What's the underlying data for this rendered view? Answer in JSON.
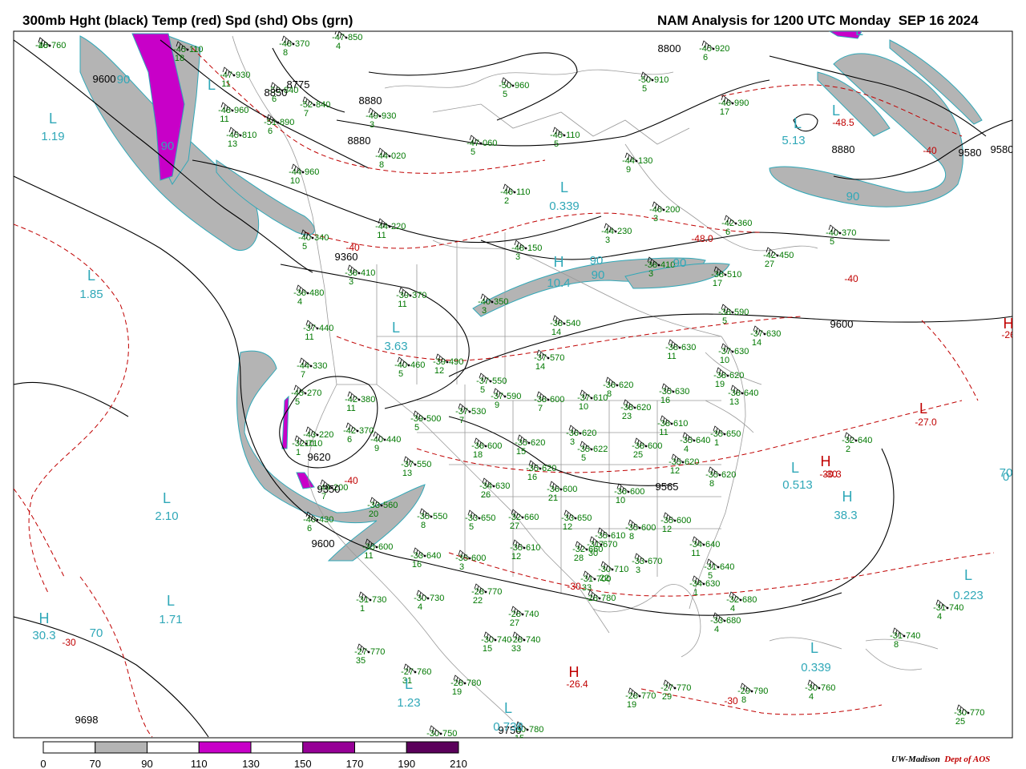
{
  "header": {
    "title_left": "300mb Hght (black) Temp (red) Spd (shd) Obs (grn)",
    "title_right": "NAM Analysis for 1200 UTC Monday  SEP 16 2024"
  },
  "legend": {
    "ticks": [
      "0",
      "70",
      "90",
      "110",
      "130",
      "150",
      "170",
      "190",
      "210"
    ],
    "fills": [
      "#ffffff",
      "#b4b4b4",
      "#ffffff",
      "#c800c8",
      "#ffffff",
      "#960096",
      "#ffffff",
      "#5a005a"
    ]
  },
  "credit": {
    "org": "UW-Madison",
    "dept": "Dept of AOS"
  },
  "colors": {
    "height_contour": "#000000",
    "temp_contour": "#c00000",
    "speed_shade_70": "#b4b4b4",
    "speed_shade_110": "#c800c8",
    "speed_label": "#30a8b8",
    "obs": "#007800",
    "land_border": "#9a9a9a"
  },
  "height_labels": [
    "9600",
    "8800",
    "8880",
    "8880",
    "8775",
    "8850",
    "8880",
    "9580",
    "9580",
    "9360",
    "9600",
    "9620",
    "9350",
    "9600",
    "9565",
    "9698",
    "9750"
  ],
  "temp_labels": [
    "-40",
    "-48.5",
    "-40",
    "-48.0",
    "-40",
    "-27.0",
    "-30",
    "-30",
    "-26.4",
    "-30",
    "-30.3",
    "-26",
    "-30",
    "-40"
  ],
  "centers": [
    {
      "t": "L",
      "v": "1.19",
      "c": "speed"
    },
    {
      "t": "L",
      "v": "1.85",
      "c": "speed"
    },
    {
      "t": "L",
      "v": "2.10",
      "c": "speed"
    },
    {
      "t": "L",
      "v": "1.71",
      "c": "speed"
    },
    {
      "t": "H",
      "v": "30.3",
      "c": "speed"
    },
    {
      "t": "L",
      "v": "1.23",
      "c": "speed"
    },
    {
      "t": "L",
      "v": "0.738",
      "c": "speed"
    },
    {
      "t": "L",
      "v": "0.339",
      "c": "speed"
    },
    {
      "t": "L",
      "v": "3.63",
      "c": "speed"
    },
    {
      "t": "H",
      "v": "10.4",
      "c": "speed"
    },
    {
      "t": "L",
      "v": "5.13",
      "c": "speed"
    },
    {
      "t": "L",
      "v": "0.513",
      "c": "speed"
    },
    {
      "t": "H",
      "v": "38.3",
      "c": "speed"
    },
    {
      "t": "L",
      "v": "0.223",
      "c": "speed"
    },
    {
      "t": "L",
      "v": "0.339",
      "c": "speed"
    },
    {
      "t": "H",
      "v": "",
      "c": "temp"
    },
    {
      "t": "H",
      "v": "",
      "c": "temp"
    },
    {
      "t": "H",
      "v": "",
      "c": "temp"
    },
    {
      "t": "L",
      "v": "",
      "c": "temp"
    },
    {
      "t": "L",
      "v": "",
      "c": "speed"
    },
    {
      "t": "L",
      "v": "",
      "c": "speed"
    },
    {
      "t": "L",
      "v": "",
      "c": "speed"
    }
  ],
  "speed_labels": [
    "90",
    "90",
    "90",
    "90",
    "90",
    "90",
    "70",
    "70",
    "0"
  ],
  "observations": [
    {
      "t": "-45",
      "v": "110",
      "d": "18"
    },
    {
      "t": "-47",
      "v": "930",
      "d": "11"
    },
    {
      "t": "-48",
      "v": "370",
      "d": "8"
    },
    {
      "t": "-47",
      "v": "850",
      "d": "4"
    },
    {
      "t": "-50",
      "v": "840",
      "d": "6"
    },
    {
      "t": "-52",
      "v": "840",
      "d": "7"
    },
    {
      "t": "-48",
      "v": "960",
      "d": "11"
    },
    {
      "t": "-51",
      "v": "890",
      "d": "6"
    },
    {
      "t": "-49",
      "v": "930",
      "d": "3"
    },
    {
      "t": "-45",
      "v": "810",
      "d": "13"
    },
    {
      "t": "-44",
      "v": "960",
      "d": "10"
    },
    {
      "t": "-44",
      "v": "020",
      "d": "8"
    },
    {
      "t": "-47",
      "v": "060",
      "d": "5"
    },
    {
      "t": "-45",
      "v": "110",
      "d": "5"
    },
    {
      "t": "-50",
      "v": "960",
      "d": "5"
    },
    {
      "t": "-45",
      "v": "920",
      "d": "6"
    },
    {
      "t": "-50",
      "v": "910",
      "d": "5"
    },
    {
      "t": "-46",
      "v": "990",
      "d": "17"
    },
    {
      "t": "-44",
      "v": "130",
      "d": "9"
    },
    {
      "t": "-46",
      "v": "110",
      "d": "2"
    },
    {
      "t": "-46",
      "v": "200",
      "d": "3"
    },
    {
      "t": "-44",
      "v": "230",
      "d": "3"
    },
    {
      "t": "-42",
      "v": "360",
      "d": "6"
    },
    {
      "t": "-40",
      "v": "370",
      "d": "5"
    },
    {
      "t": "-42",
      "v": "450",
      "d": "27"
    },
    {
      "t": "-44",
      "v": "220",
      "d": "11"
    },
    {
      "t": "-40",
      "v": "340",
      "d": "5"
    },
    {
      "t": "-48",
      "v": "150",
      "d": "3"
    },
    {
      "t": "-38",
      "v": "410",
      "d": "3"
    },
    {
      "t": "-39",
      "v": "370",
      "d": "11"
    },
    {
      "t": "-36",
      "v": "480",
      "d": "4"
    },
    {
      "t": "-40",
      "v": "350",
      "d": "3"
    },
    {
      "t": "-38",
      "v": "410",
      "d": "3"
    },
    {
      "t": "-38",
      "v": "510",
      "d": "17"
    },
    {
      "t": "-38",
      "v": "540",
      "d": "14"
    },
    {
      "t": "-37",
      "v": "440",
      "d": "11"
    },
    {
      "t": "-38",
      "v": "590",
      "d": "5"
    },
    {
      "t": "-37",
      "v": "630",
      "d": "14"
    },
    {
      "t": "-38",
      "v": "630",
      "d": "11"
    },
    {
      "t": "-37",
      "v": "630",
      "d": "10"
    },
    {
      "t": "-44",
      "v": "330",
      "d": "7"
    },
    {
      "t": "-40",
      "v": "460",
      "d": "5"
    },
    {
      "t": "-39",
      "v": "490",
      "d": "12"
    },
    {
      "t": "-37",
      "v": "570",
      "d": "14"
    },
    {
      "t": "-38",
      "v": "620",
      "d": "19"
    },
    {
      "t": "-38",
      "v": "640",
      "d": "13"
    },
    {
      "t": "-45",
      "v": "270",
      "d": "5"
    },
    {
      "t": "-42",
      "v": "380",
      "d": "11"
    },
    {
      "t": "-37",
      "v": "550",
      "d": "5"
    },
    {
      "t": "-37",
      "v": "590",
      "d": "9"
    },
    {
      "t": "-38",
      "v": "600",
      "d": "7"
    },
    {
      "t": "-37",
      "v": "610",
      "d": "10"
    },
    {
      "t": "-36",
      "v": "620",
      "d": "8"
    },
    {
      "t": "-38",
      "v": "620",
      "d": "23"
    },
    {
      "t": "-35",
      "v": "630",
      "d": "16"
    },
    {
      "t": "-43",
      "v": "220",
      "d": "10"
    },
    {
      "t": "-42",
      "v": "370",
      "d": "6"
    },
    {
      "t": "-39",
      "v": "500",
      "d": "5"
    },
    {
      "t": "-37",
      "v": "530",
      "d": "7"
    },
    {
      "t": "-38",
      "v": "610",
      "d": "11"
    },
    {
      "t": "-36",
      "v": "620",
      "d": "3"
    },
    {
      "t": "-35",
      "v": "640",
      "d": "4"
    },
    {
      "t": "-35",
      "v": "650",
      "d": "1"
    },
    {
      "t": "-40",
      "v": "440",
      "d": "9"
    },
    {
      "t": "-36",
      "v": "600",
      "d": "18"
    },
    {
      "t": "-35",
      "v": "620",
      "d": "15"
    },
    {
      "t": "-35",
      "v": "622",
      "d": "5"
    },
    {
      "t": "-38",
      "v": "600",
      "d": "25"
    },
    {
      "t": "-37",
      "v": "550",
      "d": "13"
    },
    {
      "t": "-35",
      "v": "620",
      "d": "16"
    },
    {
      "t": "-34",
      "v": "630",
      "d": "26"
    },
    {
      "t": "-36",
      "v": "600",
      "d": "21"
    },
    {
      "t": "-36",
      "v": "600",
      "d": "10"
    },
    {
      "t": "-35",
      "v": "620",
      "d": "12"
    },
    {
      "t": "-35",
      "v": "620",
      "d": "8"
    },
    {
      "t": "-32",
      "v": "640",
      "d": "2"
    },
    {
      "t": "-32",
      "v": "710",
      "d": "1"
    },
    {
      "t": "-44",
      "v": "200",
      "d": "7"
    },
    {
      "t": "-40",
      "v": "430",
      "d": "6"
    },
    {
      "t": "-33",
      "v": "560",
      "d": "20"
    },
    {
      "t": "-35",
      "v": "550",
      "d": "8"
    },
    {
      "t": "-33",
      "v": "650",
      "d": "5"
    },
    {
      "t": "-32",
      "v": "660",
      "d": "27"
    },
    {
      "t": "-33",
      "v": "650",
      "d": "12"
    },
    {
      "t": "-35",
      "v": "600",
      "d": "8"
    },
    {
      "t": "-35",
      "v": "610",
      "d": "7"
    },
    {
      "t": "-35",
      "v": "600",
      "d": "12"
    },
    {
      "t": "-35",
      "v": "600",
      "d": "11"
    },
    {
      "t": "-35",
      "v": "610",
      "d": "12"
    },
    {
      "t": "-32",
      "v": "660",
      "d": "28"
    },
    {
      "t": "-31",
      "v": "670",
      "d": "30"
    },
    {
      "t": "-33",
      "v": "640",
      "d": "16"
    },
    {
      "t": "-35",
      "v": "600",
      "d": "3"
    },
    {
      "t": "-31",
      "v": "700",
      "d": "33"
    },
    {
      "t": "-30",
      "v": "710",
      "d": "22"
    },
    {
      "t": "-33",
      "v": "670",
      "d": "3"
    },
    {
      "t": "-34",
      "v": "640",
      "d": "11"
    },
    {
      "t": "-31",
      "v": "640",
      "d": "5"
    },
    {
      "t": "-34",
      "v": "630",
      "d": "1"
    },
    {
      "t": "-32",
      "v": "680",
      "d": "4"
    },
    {
      "t": "-33",
      "v": "680",
      "d": "4"
    },
    {
      "t": "-31",
      "v": "730",
      "d": "1"
    },
    {
      "t": "-30",
      "v": "730",
      "d": "4"
    },
    {
      "t": "-28",
      "v": "770",
      "d": "22"
    },
    {
      "t": "-28",
      "v": "740",
      "d": "27"
    },
    {
      "t": "-30",
      "v": "740",
      "d": "15"
    },
    {
      "t": "-28",
      "v": "740",
      "d": "33"
    },
    {
      "t": "-27",
      "v": "770",
      "d": "35"
    },
    {
      "t": "-27",
      "v": "760",
      "d": "31"
    },
    {
      "t": "-28",
      "v": "780",
      "d": "19"
    },
    {
      "t": "-28",
      "v": "770",
      "d": "19"
    },
    {
      "t": "-27",
      "v": "770",
      "d": "29"
    },
    {
      "t": "-29",
      "v": "790",
      "d": "8"
    },
    {
      "t": "-30",
      "v": "760",
      "d": "4"
    },
    {
      "t": "-31",
      "v": "740",
      "d": "4"
    },
    {
      "t": "-31",
      "v": "740",
      "d": "8"
    },
    {
      "t": "-30",
      "v": "770",
      "d": "25"
    },
    {
      "t": "-30",
      "v": "750",
      "d": "4"
    },
    {
      "t": "-30",
      "v": "780",
      "d": "15"
    },
    {
      "t": "-28",
      "v": "780",
      "d": ""
    },
    {
      "t": "-28",
      "v": "760",
      "d": ""
    },
    {
      "t": "-40",
      "v": "",
      "d": ""
    }
  ]
}
